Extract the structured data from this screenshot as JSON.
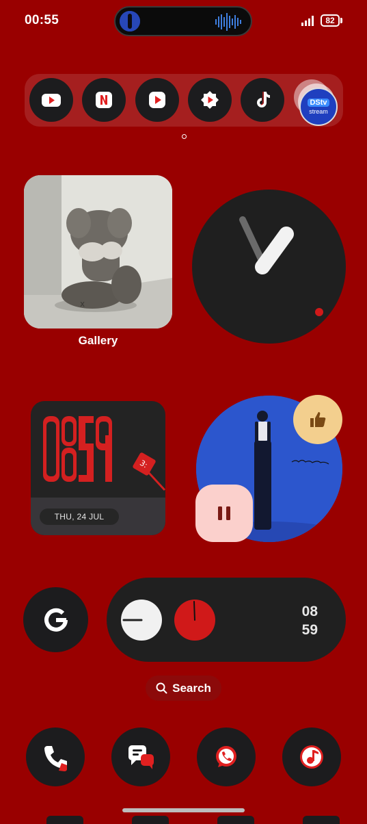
{
  "status_bar": {
    "time": "00:55",
    "battery": "82"
  },
  "top_dock": {
    "apps": [
      {
        "icon": "youtube-icon"
      },
      {
        "icon": "netflix-icon"
      },
      {
        "icon": "youtube-music-icon"
      },
      {
        "icon": "youtube-alt-icon"
      },
      {
        "icon": "tiktok-icon"
      }
    ],
    "folder": {
      "top": "DStv",
      "bottom": "stream"
    }
  },
  "gallery": {
    "label": "Gallery"
  },
  "digital_clock": {
    "date": "THU, 24 JUL"
  },
  "timer_widget": {
    "hour": "08",
    "minute": "59"
  },
  "search": {
    "label": "Search"
  },
  "bottom_dock": {
    "apps": [
      {
        "icon": "phone-icon"
      },
      {
        "icon": "messages-icon"
      },
      {
        "icon": "whatsapp-icon"
      },
      {
        "icon": "music-icon"
      }
    ]
  },
  "colors": {
    "background": "#990000",
    "accent_red": "#d01919",
    "widget_dark": "#1c1c1e",
    "like_yellow": "#f3cf8e",
    "pause_pink": "#fbd0cc"
  }
}
